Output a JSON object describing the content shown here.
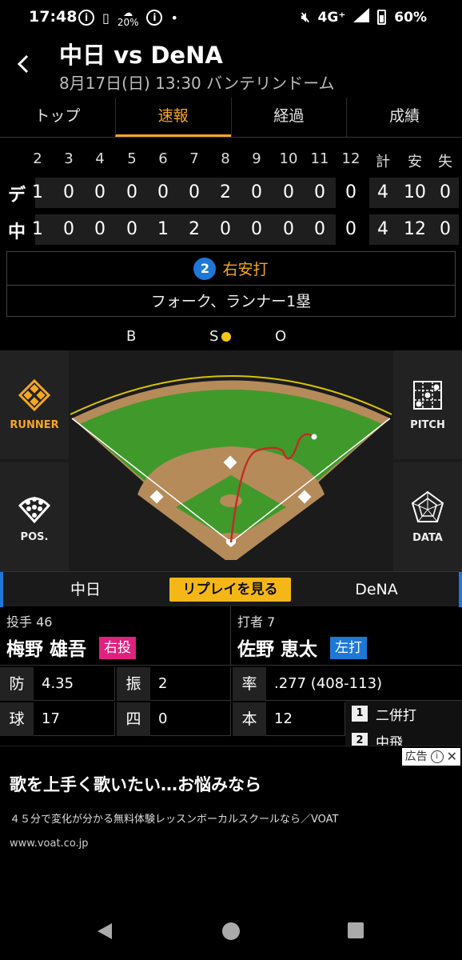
{
  "status_bar": {
    "time": "17:48",
    "weather": "20%",
    "network": "4G⁺",
    "battery": "60%"
  },
  "header": {
    "title": "中日 vs DeNA",
    "subtitle": "8月17日(日) 13:30 バンテリンドーム"
  },
  "tabs": [
    {
      "label": "トップ",
      "active": false
    },
    {
      "label": "速報",
      "active": true
    },
    {
      "label": "経過",
      "active": false
    },
    {
      "label": "成績",
      "active": false
    }
  ],
  "scoreboard": {
    "headers": [
      "2",
      "3",
      "4",
      "5",
      "6",
      "7",
      "8",
      "9",
      "10",
      "11",
      "12",
      "計",
      "安",
      "失"
    ],
    "rows": [
      {
        "team": "デ",
        "innings": [
          "1",
          "0",
          "0",
          "0",
          "0",
          "0",
          "2",
          "0",
          "0",
          "0",
          "0",
          "-"
        ],
        "totals": [
          "4",
          "10",
          "0"
        ]
      },
      {
        "team": "中",
        "innings": [
          "1",
          "0",
          "0",
          "0",
          "1",
          "2",
          "0",
          "0",
          "0",
          "0",
          "0",
          ""
        ],
        "totals": [
          "4",
          "12",
          "0"
        ]
      }
    ]
  },
  "play": {
    "pitch_number": "2",
    "result": "右安打",
    "detail": "フォーク、ランナー1塁"
  },
  "count": {
    "b": "B",
    "s": "S",
    "o": "O",
    "strikes": 1
  },
  "side_buttons": {
    "runner": "RUNNER",
    "pos": "POS.",
    "pitch": "PITCH",
    "data": "DATA"
  },
  "team_bar": {
    "home": "中日",
    "replay": "リプレイを見る",
    "away": "DeNA"
  },
  "pitcher": {
    "role": "投手",
    "number": "46",
    "name": "梅野 雄吾",
    "hand": "右投",
    "stats": [
      {
        "k": "防",
        "v": "4.35"
      },
      {
        "k": "振",
        "v": "2"
      },
      {
        "k": "球",
        "v": "17"
      },
      {
        "k": "四",
        "v": "0"
      }
    ]
  },
  "batter": {
    "role": "打者",
    "number": "7",
    "name": "佐野 恵太",
    "hand": "左打",
    "stats": [
      {
        "k": "率",
        "v": ".277 (408-113)"
      },
      {
        "k": "本",
        "v": "12"
      }
    ],
    "history": [
      {
        "n": "1",
        "label": "二併打"
      },
      {
        "n": "2",
        "label": "中飛"
      }
    ]
  },
  "ad": {
    "tag": "広告",
    "title": "歌を上手く歌いたい…お悩みなら",
    "desc": "４５分で変化が分かる無料体験レッスンボーカルスクールなら／VOAT",
    "url": "www.voat.co.jp"
  },
  "colors": {
    "accent": "#f5a623",
    "replay": "#f5b718",
    "right_pitch": "#e0217e",
    "left_bat": "#1e78d6",
    "turf": "#3f9a2b",
    "dirt": "#b58b5a"
  }
}
